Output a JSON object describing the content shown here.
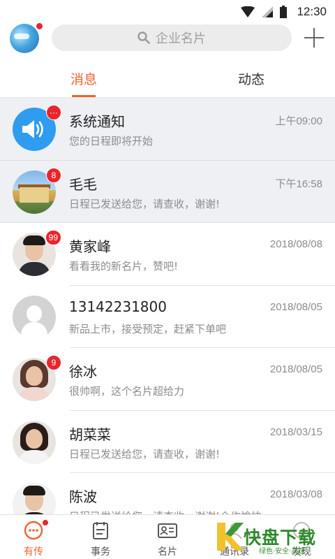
{
  "status_bar": {
    "time": "12:30"
  },
  "search": {
    "placeholder": "企业名片"
  },
  "tabs": [
    {
      "label": "消息",
      "active": true
    },
    {
      "label": "动态",
      "active": false
    }
  ],
  "messages": [
    {
      "name": "系统通知",
      "preview": "您的日程即将开始",
      "time": "上午09:00",
      "badge": "···",
      "avatar": "speaker",
      "pinned": true
    },
    {
      "name": "毛毛",
      "preview": "日程已发送给您，请查收，谢谢!",
      "time": "下午16:58",
      "badge": "8",
      "avatar": "house-photo",
      "pinned": true
    },
    {
      "name": "黄家峰",
      "preview": "看看我的新名片，赞吧!",
      "time": "2018/08/08",
      "badge": "99",
      "avatar": "male-photo",
      "pinned": false
    },
    {
      "name": "13142231800",
      "preview": "新品上市，接受预定，赶紧下单吧",
      "time": "2018/08/05",
      "badge": "",
      "avatar": "default",
      "pinned": false
    },
    {
      "name": "徐冰",
      "preview": "很帅啊，这个名片超给力",
      "time": "2018/08/05",
      "badge": "9",
      "avatar": "female-photo",
      "pinned": false
    },
    {
      "name": "胡菜菜",
      "preview": "日程已发送给您，请查收，谢谢!",
      "time": "2018/03/15",
      "badge": "",
      "avatar": "female-photo",
      "pinned": false
    },
    {
      "name": "陈波",
      "preview": "日程已发送给您，请查收，谢谢!合作愉快",
      "time": "2018/03/08",
      "badge": "",
      "avatar": "male-photo",
      "pinned": false
    }
  ],
  "bottom_nav": [
    {
      "label": "有传",
      "icon": "chat-bubble-icon",
      "active": true
    },
    {
      "label": "事务",
      "icon": "clipboard-icon",
      "active": false
    },
    {
      "label": "名片",
      "icon": "business-card-icon",
      "active": false
    },
    {
      "label": "通讯录",
      "icon": "contacts-icon",
      "active": false
    },
    {
      "label": "发现",
      "icon": "discover-icon",
      "active": false
    }
  ],
  "watermark": {
    "brand": "快盘下载",
    "slogan": "绿色·安全·高速"
  },
  "colors": {
    "accent": "#f0642d",
    "badge": "#e8262b",
    "speaker_blue": "#2f9cf0"
  }
}
